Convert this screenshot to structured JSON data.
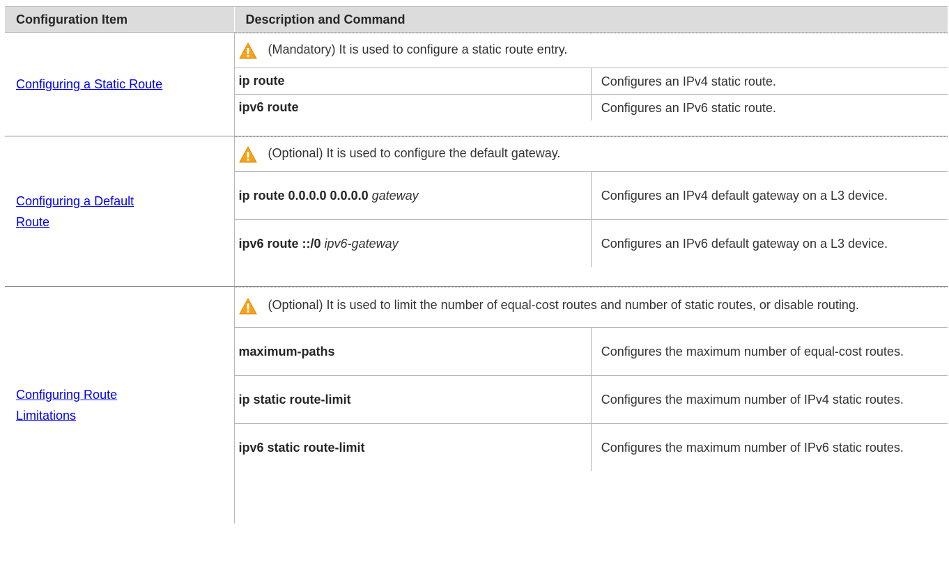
{
  "header": {
    "col1": "Configuration Item",
    "col2": "Description and Command"
  },
  "rows": [
    {
      "item": "Configuring a Static Route",
      "note": "(Mandatory) It is used to configure a static route entry.",
      "commands": [
        {
          "cmd": "ip route",
          "arg": "",
          "desc": "Configures an IPv4 static route."
        },
        {
          "cmd": "ipv6 route",
          "arg": "",
          "desc": "Configures an IPv6 static route."
        }
      ]
    },
    {
      "item_line1": "Configuring a Default ",
      "item_line2": "Route",
      "note": "(Optional) It is used to configure the default gateway.",
      "commands": [
        {
          "cmd": "ip route 0.0.0.0 0.0.0.0",
          "arg": "gateway",
          "desc": "Configures an IPv4 default gateway on a L3 device."
        },
        {
          "cmd": "ipv6 route ::/0",
          "arg": "ipv6-gateway",
          "desc": "Configures an IPv6 default gateway on a L3 device."
        }
      ]
    },
    {
      "item_line1": "Configuring Route ",
      "item_line2": "Limitations",
      "note": "(Optional) It is used to limit the number of equal-cost routes and number of static routes, or disable routing.",
      "commands": [
        {
          "cmd": "maximum-paths",
          "arg": "",
          "desc": "Configures the maximum number of equal-cost routes."
        },
        {
          "cmd": "ip static route-limit",
          "arg": "",
          "desc": "Configures the maximum number of IPv4 static routes."
        },
        {
          "cmd": "ipv6 static route-limit",
          "arg": "",
          "desc": "Configures the maximum number of IPv6 static routes."
        }
      ]
    }
  ],
  "icons": {
    "note": "warning-icon"
  },
  "colors": {
    "link": "#0000ee",
    "header_bg": "#dcdcdc",
    "warning": "#f5a31a"
  }
}
